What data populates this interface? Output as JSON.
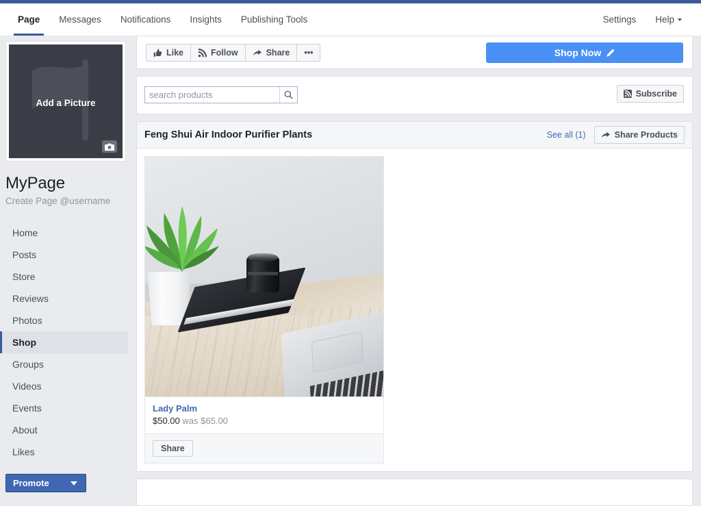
{
  "nav": {
    "left_items": [
      {
        "label": "Page",
        "active": true
      },
      {
        "label": "Messages",
        "active": false
      },
      {
        "label": "Notifications",
        "active": false
      },
      {
        "label": "Insights",
        "active": false
      },
      {
        "label": "Publishing Tools",
        "active": false
      }
    ],
    "right_items": [
      {
        "label": "Settings",
        "caret": false
      },
      {
        "label": "Help",
        "caret": true
      }
    ]
  },
  "sidebar": {
    "avatar": {
      "label": "Add a Picture",
      "camera_icon": "camera-icon",
      "placeholder_icon": "flag-icon",
      "background_color": "#3a3d45"
    },
    "page_name": "MyPage",
    "page_subtitle": "Create Page @username",
    "items": [
      {
        "label": "Home",
        "active": false
      },
      {
        "label": "Posts",
        "active": false
      },
      {
        "label": "Store",
        "active": false
      },
      {
        "label": "Reviews",
        "active": false
      },
      {
        "label": "Photos",
        "active": false
      },
      {
        "label": "Shop",
        "active": true
      },
      {
        "label": "Groups",
        "active": false
      },
      {
        "label": "Videos",
        "active": false
      },
      {
        "label": "Events",
        "active": false
      },
      {
        "label": "About",
        "active": false
      },
      {
        "label": "Likes",
        "active": false
      }
    ],
    "promote_label": "Promote"
  },
  "actions": {
    "like_label": "Like",
    "follow_label": "Follow",
    "share_label": "Share",
    "more_label": "•••",
    "shop_now_label": "Shop Now",
    "shop_now_color": "#4a90f4"
  },
  "search": {
    "value": "",
    "placeholder": "search products",
    "subscribe_label": "Subscribe"
  },
  "products_section": {
    "title": "Feng Shui Air Indoor Purifier Plants",
    "see_all_label": "See all (1)",
    "share_products_label": "Share Products",
    "items": [
      {
        "name": "Lady Palm",
        "price": "$50.00",
        "was_label": "was",
        "was_price": "$65.00",
        "share_label": "Share",
        "image_alt": "plant in white pot, camera lens on notebook, laptop on wooden desk"
      }
    ]
  },
  "theme": {
    "brand_blue": "#3b5998",
    "link_blue": "#4267b2",
    "page_background": "#e9ebee"
  }
}
